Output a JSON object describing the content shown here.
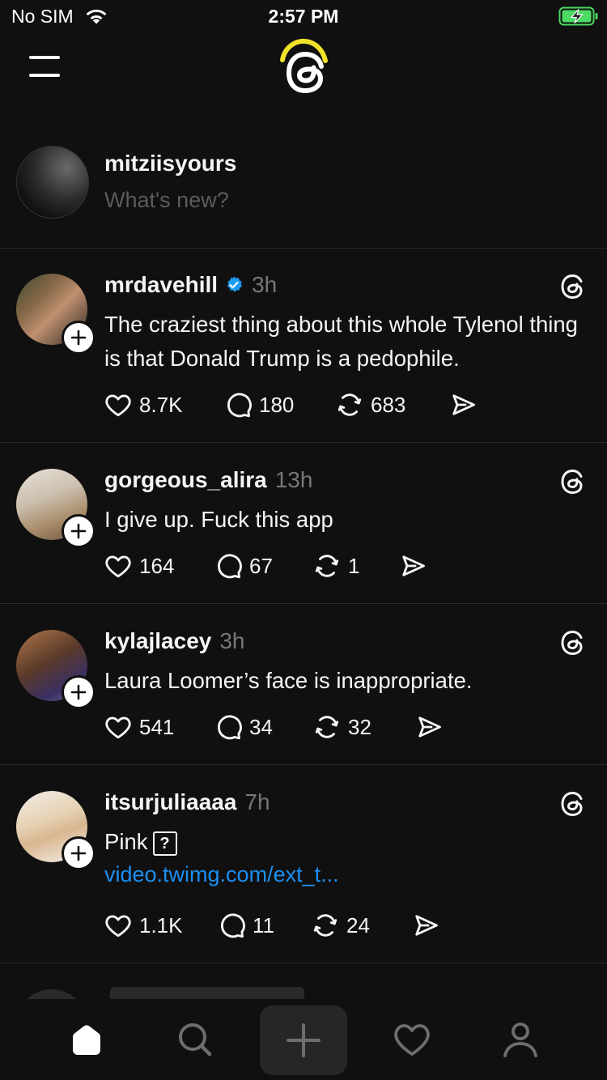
{
  "status_bar": {
    "carrier": "No SIM",
    "time": "2:57 PM"
  },
  "header": {
    "menu_icon": "menu-icon",
    "logo_icon": "threads-logo-icon"
  },
  "composer": {
    "username": "mitziisyours",
    "placeholder": "What's new?"
  },
  "posts": [
    {
      "username": "mrdavehill",
      "verified": true,
      "time": "3h",
      "text": "The craziest thing about this whole Tylenol thing is that Donald Trump is a pedophile.",
      "likes": "8.7K",
      "replies": "180",
      "reposts": "683"
    },
    {
      "username": "gorgeous_alira",
      "verified": false,
      "time": "13h",
      "text": "I give up. Fuck this app",
      "likes": "164",
      "replies": "67",
      "reposts": "1"
    },
    {
      "username": "kylajlacey",
      "verified": false,
      "time": "3h",
      "text": "Laura Loomer’s face is inappropriate.",
      "likes": "541",
      "replies": "34",
      "reposts": "32"
    },
    {
      "username": "itsurjuliaaaa",
      "verified": false,
      "time": "7h",
      "text": "Pink",
      "text_glyph": "?",
      "link": "video.twimg.com/ext_t...",
      "likes": "1.1K",
      "replies": "11",
      "reposts": "24"
    }
  ],
  "tab_bar": {
    "items": [
      "home-icon",
      "search-icon",
      "create-icon",
      "activity-heart-icon",
      "profile-icon"
    ]
  },
  "colors": {
    "background": "#101010",
    "text": "#f3f5f7",
    "muted": "#777777",
    "link": "#1d8ff3",
    "verified": "#1d9bf0",
    "logo_accent": "#f2e12a",
    "battery": "#4cd964"
  }
}
